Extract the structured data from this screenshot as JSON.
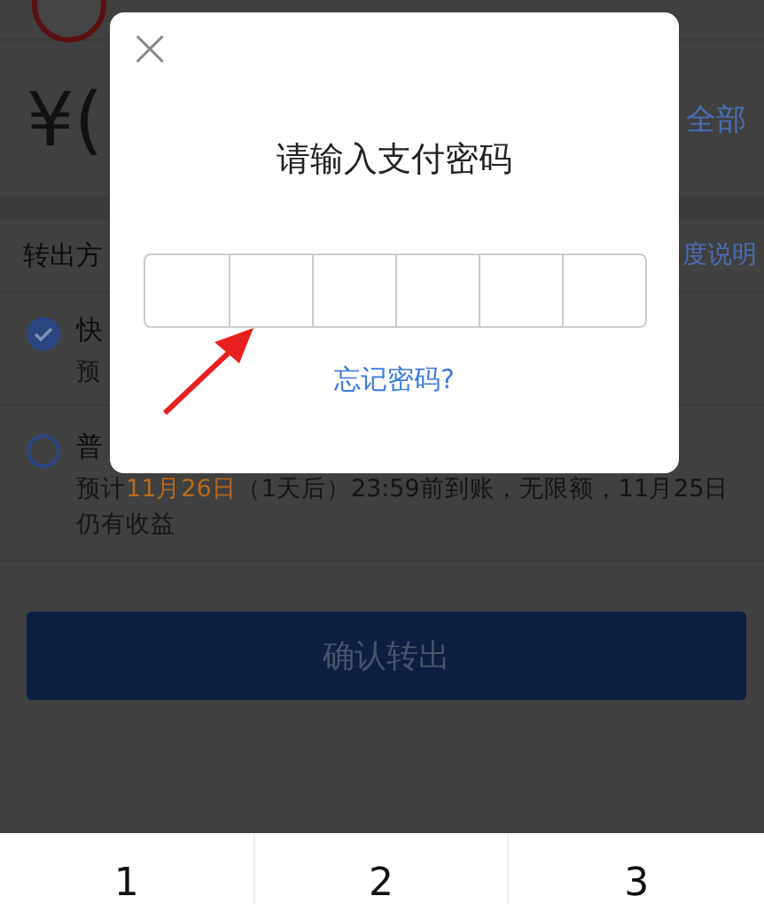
{
  "amount": {
    "currency": "¥(",
    "all_link": "全部"
  },
  "transfer_row": {
    "label": "转出方",
    "info_link": "度说明"
  },
  "options": [
    {
      "title": "快",
      "detail_prefix": "预",
      "selected": true
    },
    {
      "title": "普",
      "detail_prefix": "预计",
      "detail_highlight": "11月26日",
      "detail_suffix": "（1天后）23:59前到账，无限额，11月25日仍有收益",
      "selected": false
    }
  ],
  "confirm_button": "确认转出",
  "dialog": {
    "close": "×",
    "title": "请输入支付密码",
    "forgot_link": "忘记密码?"
  },
  "keypad": [
    "1",
    "2",
    "3"
  ]
}
